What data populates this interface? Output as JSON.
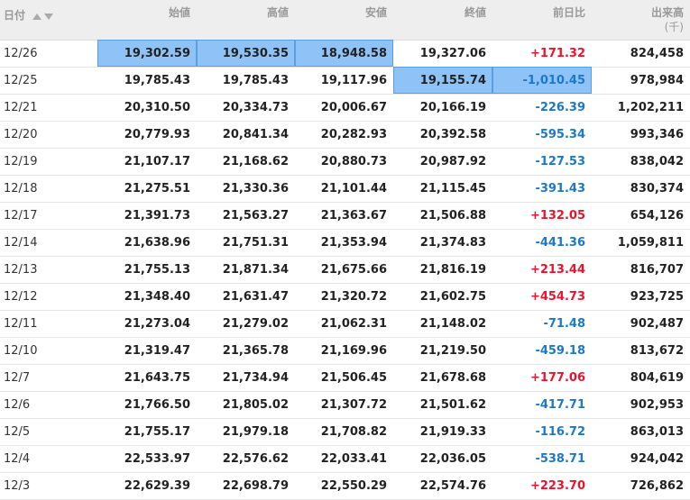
{
  "colors": {
    "positive": "#e8142e",
    "negative": "#1d78c8",
    "highlight": "#8fc3f7",
    "header_bg": "#eeeeee"
  },
  "header": {
    "date": "日付",
    "open": "始値",
    "high": "高値",
    "low": "安値",
    "close": "終値",
    "change": "前日比",
    "volume": "出来高",
    "volume_unit": "(千)",
    "sort_icon": "sort-arrows-icon"
  },
  "rows": [
    {
      "date": "12/26",
      "open": "19,302.59",
      "high": "19,530.35",
      "low": "18,948.58",
      "close": "19,327.06",
      "change": "+171.32",
      "volume": "824,458",
      "dir": "pos",
      "hl": [
        "open",
        "high",
        "low"
      ]
    },
    {
      "date": "12/25",
      "open": "19,785.43",
      "high": "19,785.43",
      "low": "19,117.96",
      "close": "19,155.74",
      "change": "-1,010.45",
      "volume": "978,984",
      "dir": "neg",
      "hl": [
        "close",
        "change"
      ]
    },
    {
      "date": "12/21",
      "open": "20,310.50",
      "high": "20,334.73",
      "low": "20,006.67",
      "close": "20,166.19",
      "change": "-226.39",
      "volume": "1,202,211",
      "dir": "neg",
      "hl": []
    },
    {
      "date": "12/20",
      "open": "20,779.93",
      "high": "20,841.34",
      "low": "20,282.93",
      "close": "20,392.58",
      "change": "-595.34",
      "volume": "993,346",
      "dir": "neg",
      "hl": []
    },
    {
      "date": "12/19",
      "open": "21,107.17",
      "high": "21,168.62",
      "low": "20,880.73",
      "close": "20,987.92",
      "change": "-127.53",
      "volume": "838,042",
      "dir": "neg",
      "hl": []
    },
    {
      "date": "12/18",
      "open": "21,275.51",
      "high": "21,330.36",
      "low": "21,101.44",
      "close": "21,115.45",
      "change": "-391.43",
      "volume": "830,374",
      "dir": "neg",
      "hl": []
    },
    {
      "date": "12/17",
      "open": "21,391.73",
      "high": "21,563.27",
      "low": "21,363.67",
      "close": "21,506.88",
      "change": "+132.05",
      "volume": "654,126",
      "dir": "pos",
      "hl": []
    },
    {
      "date": "12/14",
      "open": "21,638.96",
      "high": "21,751.31",
      "low": "21,353.94",
      "close": "21,374.83",
      "change": "-441.36",
      "volume": "1,059,811",
      "dir": "neg",
      "hl": []
    },
    {
      "date": "12/13",
      "open": "21,755.13",
      "high": "21,871.34",
      "low": "21,675.66",
      "close": "21,816.19",
      "change": "+213.44",
      "volume": "816,707",
      "dir": "pos",
      "hl": []
    },
    {
      "date": "12/12",
      "open": "21,348.40",
      "high": "21,631.47",
      "low": "21,320.72",
      "close": "21,602.75",
      "change": "+454.73",
      "volume": "923,725",
      "dir": "pos",
      "hl": []
    },
    {
      "date": "12/11",
      "open": "21,273.04",
      "high": "21,279.02",
      "low": "21,062.31",
      "close": "21,148.02",
      "change": "-71.48",
      "volume": "902,487",
      "dir": "neg",
      "hl": []
    },
    {
      "date": "12/10",
      "open": "21,319.47",
      "high": "21,365.78",
      "low": "21,169.96",
      "close": "21,219.50",
      "change": "-459.18",
      "volume": "813,672",
      "dir": "neg",
      "hl": []
    },
    {
      "date": "12/7",
      "open": "21,643.75",
      "high": "21,734.94",
      "low": "21,506.45",
      "close": "21,678.68",
      "change": "+177.06",
      "volume": "804,619",
      "dir": "pos",
      "hl": []
    },
    {
      "date": "12/6",
      "open": "21,766.50",
      "high": "21,805.02",
      "low": "21,307.72",
      "close": "21,501.62",
      "change": "-417.71",
      "volume": "902,953",
      "dir": "neg",
      "hl": []
    },
    {
      "date": "12/5",
      "open": "21,755.17",
      "high": "21,979.18",
      "low": "21,708.82",
      "close": "21,919.33",
      "change": "-116.72",
      "volume": "863,013",
      "dir": "neg",
      "hl": []
    },
    {
      "date": "12/4",
      "open": "22,533.97",
      "high": "22,576.62",
      "low": "22,033.41",
      "close": "22,036.05",
      "change": "-538.71",
      "volume": "924,042",
      "dir": "neg",
      "hl": []
    },
    {
      "date": "12/3",
      "open": "22,629.39",
      "high": "22,698.79",
      "low": "22,550.29",
      "close": "22,574.76",
      "change": "+223.70",
      "volume": "726,862",
      "dir": "pos",
      "hl": []
    }
  ]
}
